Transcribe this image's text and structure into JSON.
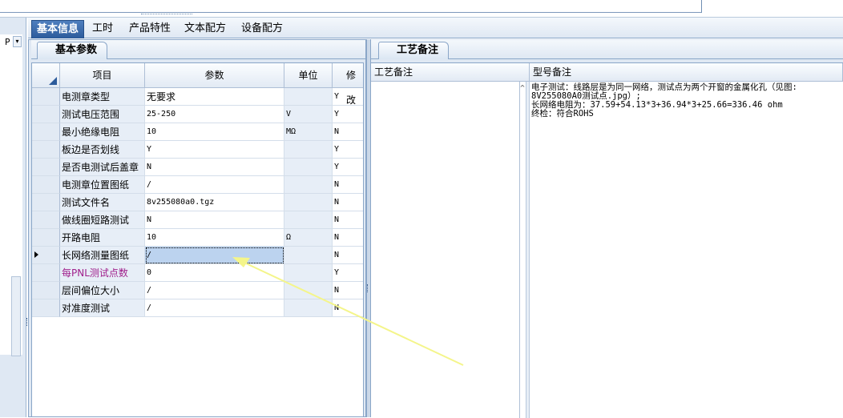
{
  "main_tabs": [
    "基本信息",
    "工时",
    "产品特性",
    "文本配方",
    "设备配方"
  ],
  "left_panel": {
    "subtab": "基本参数",
    "columns": [
      "项目",
      "参数",
      "单位",
      "修改"
    ],
    "rows": [
      {
        "name": "电测章类型",
        "value": "无要求",
        "unit": "",
        "mod": "Y"
      },
      {
        "name": "测试电压范围",
        "value": "25-250",
        "unit": "V",
        "mod": "Y"
      },
      {
        "name": "最小绝缘电阻",
        "value": "10",
        "unit": "MΩ",
        "mod": "N"
      },
      {
        "name": "板边是否划线",
        "value": "Y",
        "unit": "",
        "mod": "Y"
      },
      {
        "name": "是否电测试后盖章",
        "value": "N",
        "unit": "",
        "mod": "Y"
      },
      {
        "name": "电测章位置图纸",
        "value": "/",
        "unit": "",
        "mod": "N"
      },
      {
        "name": "测试文件名",
        "value": "8v255080a0.tgz",
        "unit": "",
        "mod": "N"
      },
      {
        "name": "做线圈短路测试",
        "value": "N",
        "unit": "",
        "mod": "N"
      },
      {
        "name": "开路电阻",
        "value": "10",
        "unit": "Ω",
        "mod": "N"
      },
      {
        "name": "长网络测量图纸",
        "value": "/",
        "unit": "",
        "mod": "N"
      },
      {
        "name": "每PNL测试点数",
        "value": "0",
        "unit": "",
        "mod": "Y"
      },
      {
        "name": "层间偏位大小",
        "value": "/",
        "unit": "",
        "mod": "N"
      },
      {
        "name": "对准度测试",
        "value": "/",
        "unit": "",
        "mod": "N"
      }
    ]
  },
  "right_panel": {
    "subtab": "工艺备注",
    "columns": [
      "工艺备注",
      "型号备注"
    ],
    "remark_lines": [
      "电子测试：线路层是为同一网络，测试点为两个开窗的金属化孔（见图:",
      "8V255080A0测试点.jpg）;",
      "长网络电阻为：37.59+54.13*3+36.94*3+25.66=336.46 ohm",
      "终检：符合ROHS"
    ]
  },
  "left_strip": {
    "letter": "P",
    "scroll_glyph": "▾"
  },
  "colors": {
    "accent": "#2c5b9b",
    "selected_cell": "#bcd3ef",
    "highlight_label": "#a0208c",
    "arrow": "#f4f58a"
  }
}
